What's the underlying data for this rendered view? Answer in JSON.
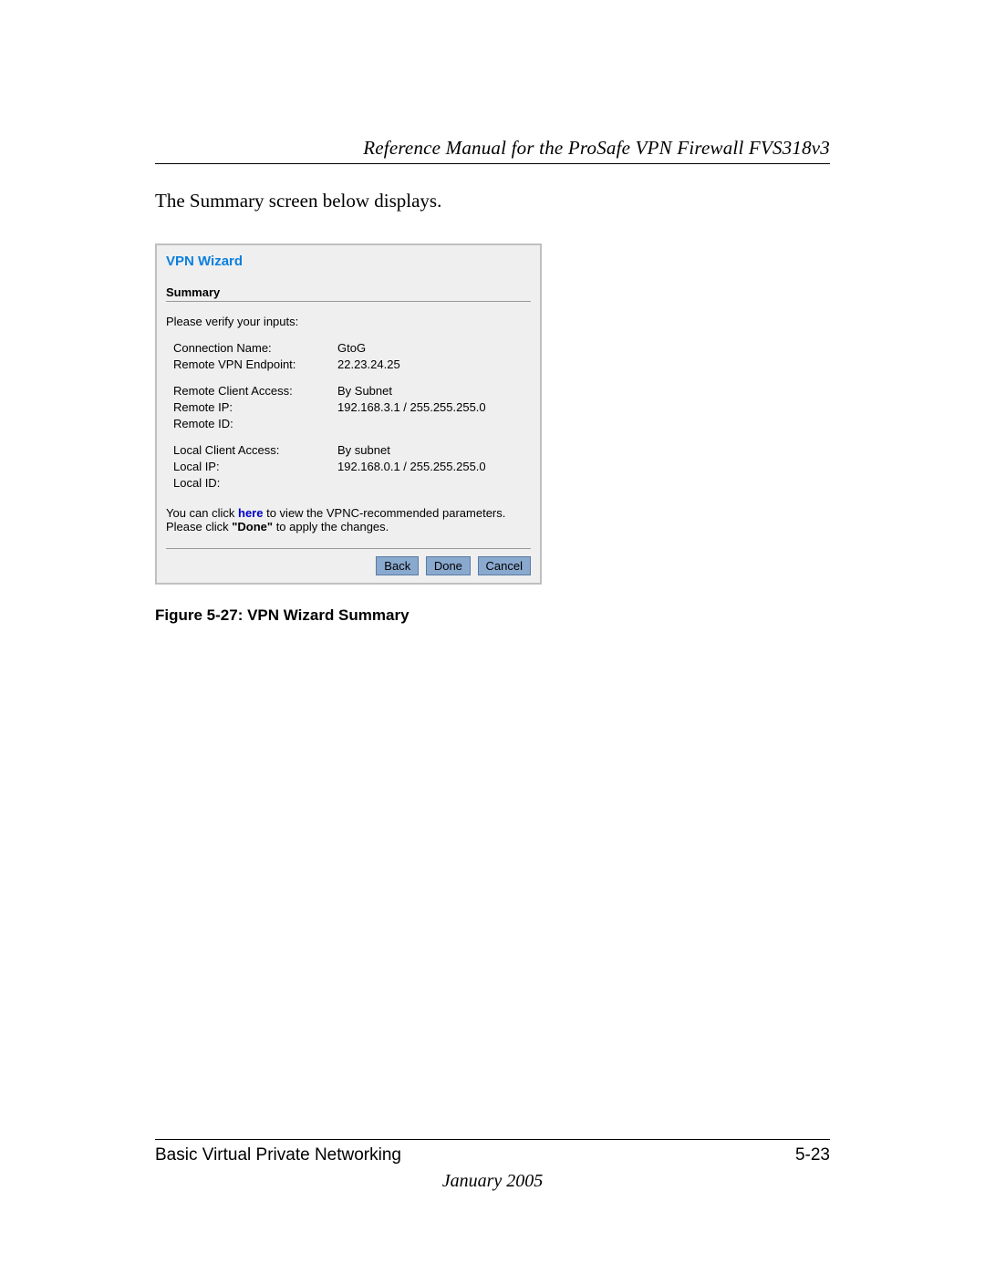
{
  "header": {
    "title": "Reference Manual for the ProSafe VPN Firewall FVS318v3"
  },
  "intro_text": "The Summary screen below displays.",
  "wizard": {
    "title": "VPN Wizard",
    "section_label": "Summary",
    "verify_prompt": "Please verify your inputs:",
    "block1": [
      {
        "key": "Connection Name:",
        "val": "GtoG"
      },
      {
        "key": "Remote VPN Endpoint:",
        "val": "22.23.24.25"
      }
    ],
    "block2": [
      {
        "key": "Remote Client Access:",
        "val": "By Subnet"
      },
      {
        "key": "Remote IP:",
        "val": "192.168.3.1 / 255.255.255.0"
      },
      {
        "key": "Remote ID:",
        "val": ""
      }
    ],
    "block3": [
      {
        "key": "Local Client Access:",
        "val": "By subnet"
      },
      {
        "key": "Local IP:",
        "val": "192.168.0.1 / 255.255.255.0"
      },
      {
        "key": "Local ID:",
        "val": ""
      }
    ],
    "footnote": {
      "pre": "You can click ",
      "link": "here",
      "post": " to view the VPNC-recommended parameters.",
      "apply_pre": "Please click ",
      "apply_bold": "\"Done\"",
      "apply_post": " to apply the changes."
    },
    "buttons": {
      "back": "Back",
      "done": "Done",
      "cancel": "Cancel"
    }
  },
  "figure_caption": "Figure 5-27:  VPN Wizard Summary",
  "footer": {
    "section": "Basic Virtual Private Networking",
    "page": "5-23",
    "date": "January 2005"
  }
}
